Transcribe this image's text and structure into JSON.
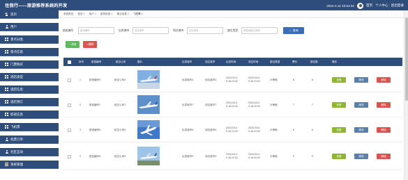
{
  "header": {
    "title": "住我行——旅游推荐系统的开发",
    "datetime": "2024-4-11 10:54:31",
    "links": [
      "首页",
      "个人中心",
      "退出登录"
    ]
  },
  "sidebar": {
    "items": [
      {
        "label": "首页",
        "icon": "home-icon"
      },
      {
        "label": "用户",
        "icon": "user-icon"
      },
      {
        "label": "景点分类",
        "icon": "grid-icon"
      },
      {
        "label": "景点信息",
        "icon": "grid-icon"
      },
      {
        "label": "门票购买",
        "icon": "grid-icon"
      },
      {
        "label": "酒店类型",
        "icon": "grid-icon"
      },
      {
        "label": "酒店信息",
        "icon": "grid-icon"
      },
      {
        "label": "酒店预订",
        "icon": "grid-icon"
      },
      {
        "label": "航班信息",
        "icon": "grid-icon"
      },
      {
        "label": "飞机票",
        "icon": "grid-icon"
      },
      {
        "label": "机票订单",
        "icon": "user-icon"
      },
      {
        "label": "社区互动",
        "icon": "user-icon"
      },
      {
        "label": "系统管理",
        "icon": "lines-icon"
      }
    ]
  },
  "tabs": [
    "系统首页",
    "首页 ×",
    "用户 ×",
    "航班信息 ×",
    "景点信息 ×",
    "飞机票 ×"
  ],
  "search": {
    "fields": [
      {
        "label": "航班编号",
        "placeholder": "航班编号"
      },
      {
        "label": "出发城市",
        "placeholder": "出发城市"
      },
      {
        "label": "到达城市",
        "placeholder": "到达城市"
      },
      {
        "label": "座位类型",
        "placeholder": "请选择座位类型"
      }
    ],
    "query_label": "查询"
  },
  "actions": {
    "add_label": "添加",
    "delete_label": "删除"
  },
  "table": {
    "headers": [
      "序号",
      "航班编号",
      "航空公司",
      "图片",
      "出发城市",
      "到达城市",
      "出发时间",
      "到达时间",
      "座位类型",
      "票价",
      "座位数",
      "操作"
    ],
    "rows": [
      {
        "index": "1",
        "flight_no": "航班编号4",
        "airline": "航空公司4",
        "depart_city": "出发城市4",
        "arrive_city": "到达城市4",
        "depart_time": "2024-04-0\n9 18:12:02",
        "arrive_time": "2024-04-0\n9 18:12:02",
        "seat_type": "头等舱",
        "price": "8",
        "seats": "8"
      },
      {
        "index": "2",
        "flight_no": "航班编号7",
        "airline": "航空公司7",
        "depart_city": "出发城市7",
        "arrive_city": "到达城市7",
        "depart_time": "2024-04-0\n9 18:12:02",
        "arrive_time": "2024-04-0\n9 18:12:02",
        "seat_type": "头等舱",
        "price": "7",
        "seats": "7"
      },
      {
        "index": "3",
        "flight_no": "航班编号6",
        "airline": "航空公司6",
        "depart_city": "出发城市6",
        "arrive_city": "到达城市6",
        "depart_time": "2024-04-0\n9 18:12:02",
        "arrive_time": "2024-04-0\n9 18:12:02",
        "seat_type": "头等舱",
        "price": "6",
        "seats": "6"
      },
      {
        "index": "4",
        "flight_no": "航班编号5",
        "airline": "航空公司5",
        "depart_city": "出发城市5",
        "arrive_city": "到达城市5",
        "depart_time": "2024-04-0\n9 18:12:02",
        "arrive_time": "2024-04-0\n9 18:12:02",
        "seat_type": "头等舱",
        "price": "5",
        "seats": "5"
      }
    ],
    "row_actions": {
      "view": "查看",
      "edit": "修改",
      "delete": "删除"
    }
  },
  "colors": {
    "primary": "#2f4d7a",
    "success": "#5cb85c",
    "danger": "#d9534f",
    "view": "#8fb534",
    "edit": "#5b7fa8"
  }
}
